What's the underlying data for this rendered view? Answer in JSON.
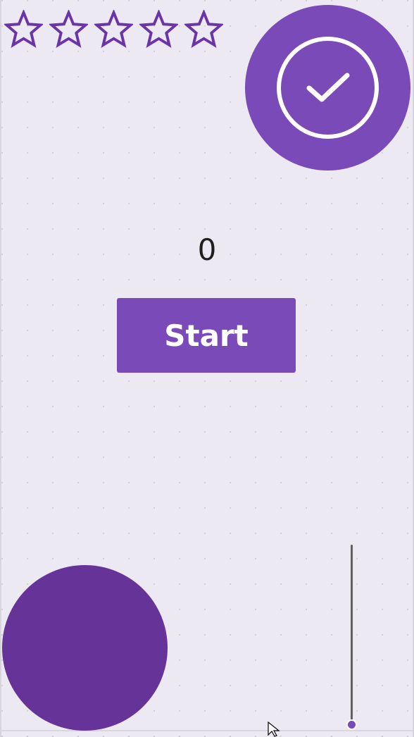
{
  "rating": {
    "max_stars": 5,
    "filled": 0,
    "icons": [
      "star-outline-icon",
      "star-outline-icon",
      "star-outline-icon",
      "star-outline-icon",
      "star-outline-icon"
    ]
  },
  "check_button": {
    "icon": "check-circle-icon"
  },
  "counter": {
    "value": "0"
  },
  "start_button": {
    "label": "Start"
  },
  "slider": {
    "value_fraction": 0.0
  },
  "colors": {
    "background": "#ede9f3",
    "accent": "#7a4bb8",
    "star_stroke": "#6a35a6",
    "dark_circle": "#663399",
    "white": "#ffffff",
    "text": "#1f1f1f",
    "track": "#606060"
  }
}
